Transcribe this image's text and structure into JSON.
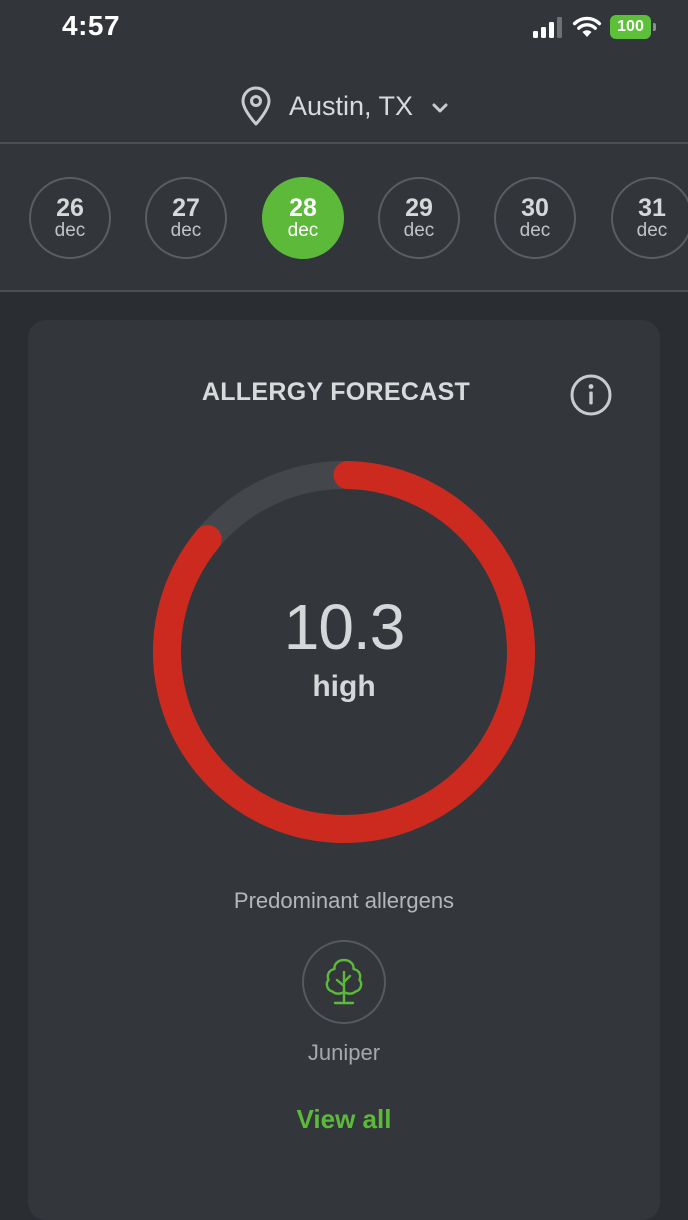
{
  "status_bar": {
    "time": "4:57",
    "battery": "100"
  },
  "location": {
    "name": "Austin, TX"
  },
  "dates": [
    {
      "day": "26",
      "month": "dec",
      "active": false
    },
    {
      "day": "27",
      "month": "dec",
      "active": false
    },
    {
      "day": "28",
      "month": "dec",
      "active": true
    },
    {
      "day": "29",
      "month": "dec",
      "active": false
    },
    {
      "day": "30",
      "month": "dec",
      "active": false
    },
    {
      "day": "31",
      "month": "dec",
      "active": false
    }
  ],
  "forecast": {
    "title": "ALLERGY FORECAST",
    "value": "10.3",
    "level": "high",
    "gauge_fraction": 0.86,
    "predominant_label": "Predominant allergens",
    "allergen": "Juniper",
    "view_all_label": "View all"
  },
  "colors": {
    "accent_green": "#5cb93a",
    "gauge_red": "#cc2a1f",
    "gauge_track": "#43474b",
    "background": "#2a2e33"
  },
  "icons": {
    "location": "map-pin-icon",
    "chevron": "chevron-down-icon",
    "info": "info-icon",
    "allergen": "tree-icon"
  }
}
